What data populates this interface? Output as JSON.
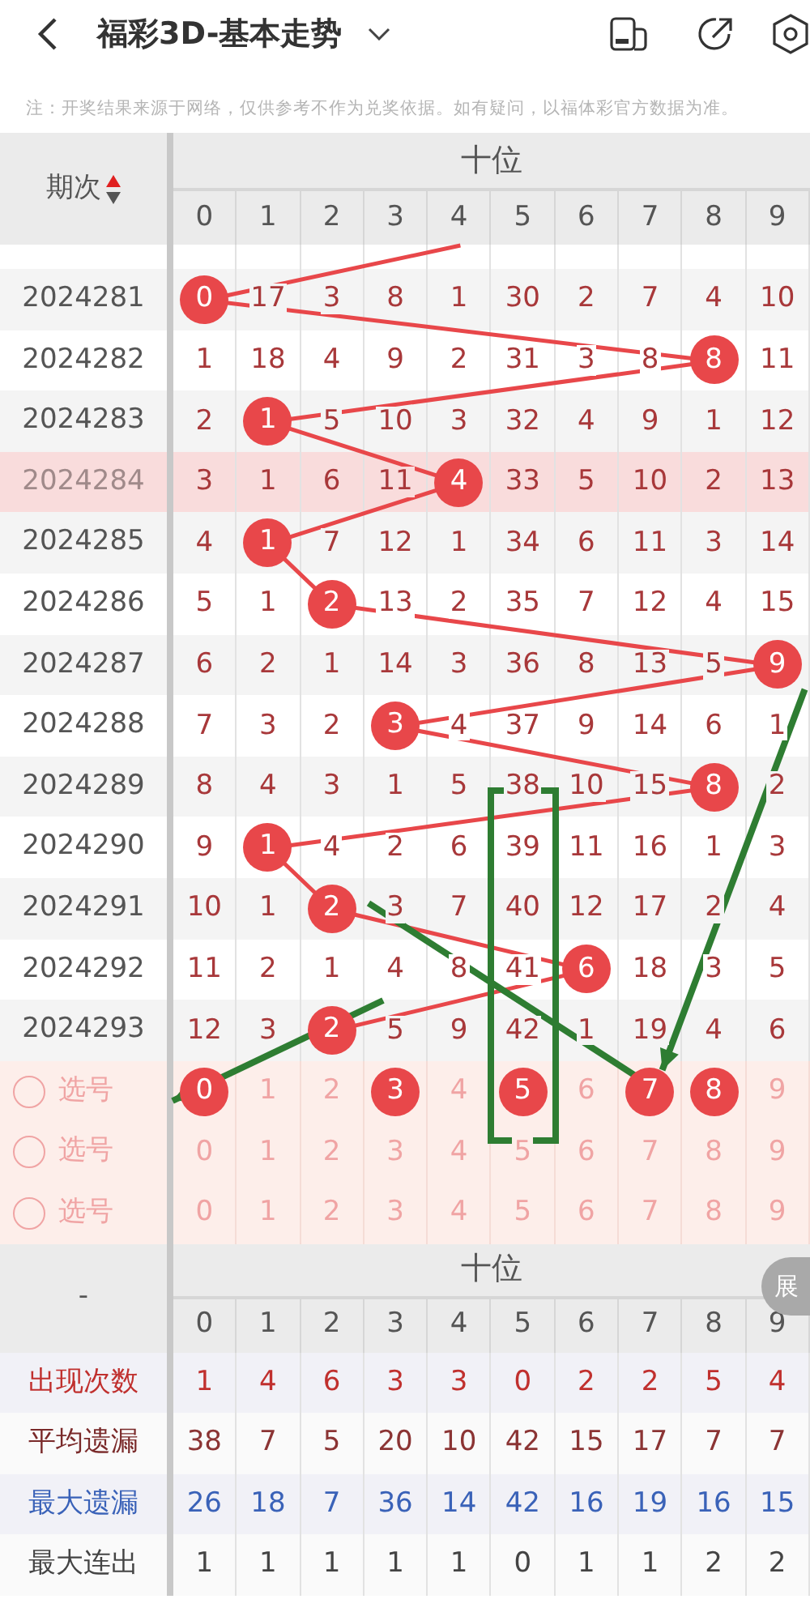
{
  "app_bar": {
    "title": "福彩3D-基本走势"
  },
  "note": "注：开奖结果来源于网络，仅供参考不作为兑奖依据。如有疑问，以福体彩官方数据为准。",
  "table": {
    "issue_header": "期次",
    "group_header": "十位",
    "digit_headers": [
      "0",
      "1",
      "2",
      "3",
      "4",
      "5",
      "6",
      "7",
      "8",
      "9"
    ],
    "rows": [
      {
        "issue": "2024281",
        "selected": false,
        "cells": [
          {
            "t": "0",
            "hit": true
          },
          {
            "t": "17",
            "hit": false
          },
          {
            "t": "3",
            "hit": false
          },
          {
            "t": "8",
            "hit": false
          },
          {
            "t": "1",
            "hit": false
          },
          {
            "t": "30",
            "hit": false
          },
          {
            "t": "2",
            "hit": false
          },
          {
            "t": "7",
            "hit": false
          },
          {
            "t": "4",
            "hit": false
          },
          {
            "t": "10",
            "hit": false
          }
        ]
      },
      {
        "issue": "2024282",
        "selected": false,
        "cells": [
          {
            "t": "1",
            "hit": false
          },
          {
            "t": "18",
            "hit": false
          },
          {
            "t": "4",
            "hit": false
          },
          {
            "t": "9",
            "hit": false
          },
          {
            "t": "2",
            "hit": false
          },
          {
            "t": "31",
            "hit": false
          },
          {
            "t": "3",
            "hit": false
          },
          {
            "t": "8",
            "hit": false
          },
          {
            "t": "8",
            "hit": true
          },
          {
            "t": "11",
            "hit": false
          }
        ]
      },
      {
        "issue": "2024283",
        "selected": false,
        "cells": [
          {
            "t": "2",
            "hit": false
          },
          {
            "t": "1",
            "hit": true
          },
          {
            "t": "5",
            "hit": false
          },
          {
            "t": "10",
            "hit": false
          },
          {
            "t": "3",
            "hit": false
          },
          {
            "t": "32",
            "hit": false
          },
          {
            "t": "4",
            "hit": false
          },
          {
            "t": "9",
            "hit": false
          },
          {
            "t": "1",
            "hit": false
          },
          {
            "t": "12",
            "hit": false
          }
        ]
      },
      {
        "issue": "2024284",
        "selected": true,
        "cells": [
          {
            "t": "3",
            "hit": false
          },
          {
            "t": "1",
            "hit": false
          },
          {
            "t": "6",
            "hit": false
          },
          {
            "t": "11",
            "hit": false
          },
          {
            "t": "4",
            "hit": true
          },
          {
            "t": "33",
            "hit": false
          },
          {
            "t": "5",
            "hit": false
          },
          {
            "t": "10",
            "hit": false
          },
          {
            "t": "2",
            "hit": false
          },
          {
            "t": "13",
            "hit": false
          }
        ]
      },
      {
        "issue": "2024285",
        "selected": false,
        "cells": [
          {
            "t": "4",
            "hit": false
          },
          {
            "t": "1",
            "hit": true
          },
          {
            "t": "7",
            "hit": false
          },
          {
            "t": "12",
            "hit": false
          },
          {
            "t": "1",
            "hit": false
          },
          {
            "t": "34",
            "hit": false
          },
          {
            "t": "6",
            "hit": false
          },
          {
            "t": "11",
            "hit": false
          },
          {
            "t": "3",
            "hit": false
          },
          {
            "t": "14",
            "hit": false
          }
        ]
      },
      {
        "issue": "2024286",
        "selected": false,
        "cells": [
          {
            "t": "5",
            "hit": false
          },
          {
            "t": "1",
            "hit": false
          },
          {
            "t": "2",
            "hit": true
          },
          {
            "t": "13",
            "hit": false
          },
          {
            "t": "2",
            "hit": false
          },
          {
            "t": "35",
            "hit": false
          },
          {
            "t": "7",
            "hit": false
          },
          {
            "t": "12",
            "hit": false
          },
          {
            "t": "4",
            "hit": false
          },
          {
            "t": "15",
            "hit": false
          }
        ]
      },
      {
        "issue": "2024287",
        "selected": false,
        "cells": [
          {
            "t": "6",
            "hit": false
          },
          {
            "t": "2",
            "hit": false
          },
          {
            "t": "1",
            "hit": false
          },
          {
            "t": "14",
            "hit": false
          },
          {
            "t": "3",
            "hit": false
          },
          {
            "t": "36",
            "hit": false
          },
          {
            "t": "8",
            "hit": false
          },
          {
            "t": "13",
            "hit": false
          },
          {
            "t": "5",
            "hit": false
          },
          {
            "t": "9",
            "hit": true
          }
        ]
      },
      {
        "issue": "2024288",
        "selected": false,
        "cells": [
          {
            "t": "7",
            "hit": false
          },
          {
            "t": "3",
            "hit": false
          },
          {
            "t": "2",
            "hit": false
          },
          {
            "t": "3",
            "hit": true
          },
          {
            "t": "4",
            "hit": false
          },
          {
            "t": "37",
            "hit": false
          },
          {
            "t": "9",
            "hit": false
          },
          {
            "t": "14",
            "hit": false
          },
          {
            "t": "6",
            "hit": false
          },
          {
            "t": "1",
            "hit": false
          }
        ]
      },
      {
        "issue": "2024289",
        "selected": false,
        "cells": [
          {
            "t": "8",
            "hit": false
          },
          {
            "t": "4",
            "hit": false
          },
          {
            "t": "3",
            "hit": false
          },
          {
            "t": "1",
            "hit": false
          },
          {
            "t": "5",
            "hit": false
          },
          {
            "t": "38",
            "hit": false
          },
          {
            "t": "10",
            "hit": false
          },
          {
            "t": "15",
            "hit": false
          },
          {
            "t": "8",
            "hit": true
          },
          {
            "t": "2",
            "hit": false
          }
        ]
      },
      {
        "issue": "2024290",
        "selected": false,
        "cells": [
          {
            "t": "9",
            "hit": false
          },
          {
            "t": "1",
            "hit": true
          },
          {
            "t": "4",
            "hit": false
          },
          {
            "t": "2",
            "hit": false
          },
          {
            "t": "6",
            "hit": false
          },
          {
            "t": "39",
            "hit": false
          },
          {
            "t": "11",
            "hit": false
          },
          {
            "t": "16",
            "hit": false
          },
          {
            "t": "1",
            "hit": false
          },
          {
            "t": "3",
            "hit": false
          }
        ]
      },
      {
        "issue": "2024291",
        "selected": false,
        "cells": [
          {
            "t": "10",
            "hit": false
          },
          {
            "t": "1",
            "hit": false
          },
          {
            "t": "2",
            "hit": true
          },
          {
            "t": "3",
            "hit": false
          },
          {
            "t": "7",
            "hit": false
          },
          {
            "t": "40",
            "hit": false
          },
          {
            "t": "12",
            "hit": false
          },
          {
            "t": "17",
            "hit": false
          },
          {
            "t": "2",
            "hit": false
          },
          {
            "t": "4",
            "hit": false
          }
        ]
      },
      {
        "issue": "2024292",
        "selected": false,
        "cells": [
          {
            "t": "11",
            "hit": false
          },
          {
            "t": "2",
            "hit": false
          },
          {
            "t": "1",
            "hit": false
          },
          {
            "t": "4",
            "hit": false
          },
          {
            "t": "8",
            "hit": false
          },
          {
            "t": "41",
            "hit": false
          },
          {
            "t": "6",
            "hit": true
          },
          {
            "t": "18",
            "hit": false
          },
          {
            "t": "3",
            "hit": false
          },
          {
            "t": "5",
            "hit": false
          }
        ]
      },
      {
        "issue": "2024293",
        "selected": false,
        "cells": [
          {
            "t": "12",
            "hit": false
          },
          {
            "t": "3",
            "hit": false
          },
          {
            "t": "2",
            "hit": true
          },
          {
            "t": "5",
            "hit": false
          },
          {
            "t": "9",
            "hit": false
          },
          {
            "t": "42",
            "hit": false
          },
          {
            "t": "1",
            "hit": false
          },
          {
            "t": "19",
            "hit": false
          },
          {
            "t": "4",
            "hit": false
          },
          {
            "t": "6",
            "hit": false
          }
        ]
      }
    ],
    "pick_rows": [
      {
        "label": "选号",
        "checked": false,
        "cells": [
          {
            "t": "0",
            "picked": true
          },
          {
            "t": "1",
            "picked": false
          },
          {
            "t": "2",
            "picked": false
          },
          {
            "t": "3",
            "picked": true
          },
          {
            "t": "4",
            "picked": false
          },
          {
            "t": "5",
            "picked": true
          },
          {
            "t": "6",
            "picked": false
          },
          {
            "t": "7",
            "picked": true
          },
          {
            "t": "8",
            "picked": true
          },
          {
            "t": "9",
            "picked": false
          }
        ]
      },
      {
        "label": "选号",
        "checked": false,
        "cells": [
          {
            "t": "0",
            "picked": false
          },
          {
            "t": "1",
            "picked": false
          },
          {
            "t": "2",
            "picked": false
          },
          {
            "t": "3",
            "picked": false
          },
          {
            "t": "4",
            "picked": false
          },
          {
            "t": "5",
            "picked": false
          },
          {
            "t": "6",
            "picked": false
          },
          {
            "t": "7",
            "picked": false
          },
          {
            "t": "8",
            "picked": false
          },
          {
            "t": "9",
            "picked": false
          }
        ]
      },
      {
        "label": "选号",
        "checked": false,
        "cells": [
          {
            "t": "0",
            "picked": false
          },
          {
            "t": "1",
            "picked": false
          },
          {
            "t": "2",
            "picked": false
          },
          {
            "t": "3",
            "picked": false
          },
          {
            "t": "4",
            "picked": false
          },
          {
            "t": "5",
            "picked": false
          },
          {
            "t": "6",
            "picked": false
          },
          {
            "t": "7",
            "picked": false
          },
          {
            "t": "8",
            "picked": false
          },
          {
            "t": "9",
            "picked": false
          }
        ]
      }
    ]
  },
  "summary": {
    "corner": "-",
    "group_header": "十位",
    "digit_headers": [
      "0",
      "1",
      "2",
      "3",
      "4",
      "5",
      "6",
      "7",
      "8",
      "9"
    ],
    "rows": [
      {
        "kind": "count",
        "label": "出现次数",
        "values": [
          "1",
          "4",
          "6",
          "3",
          "3",
          "0",
          "2",
          "2",
          "5",
          "4"
        ]
      },
      {
        "kind": "average_miss",
        "label": "平均遗漏",
        "values": [
          "38",
          "7",
          "5",
          "20",
          "10",
          "42",
          "15",
          "17",
          "7",
          "7"
        ]
      },
      {
        "kind": "max_miss",
        "label": "最大遗漏",
        "values": [
          "26",
          "18",
          "7",
          "36",
          "14",
          "42",
          "16",
          "19",
          "16",
          "15"
        ]
      },
      {
        "kind": "max_run",
        "label": "最大连出",
        "values": [
          "1",
          "1",
          "1",
          "1",
          "1",
          "0",
          "1",
          "1",
          "2",
          "2"
        ]
      }
    ]
  },
  "expand_tab": "展",
  "annotations": [
    {
      "kind": "box"
    },
    {
      "kind": "arrow"
    },
    {
      "kind": "arrow"
    },
    {
      "kind": "arrow"
    }
  ]
}
